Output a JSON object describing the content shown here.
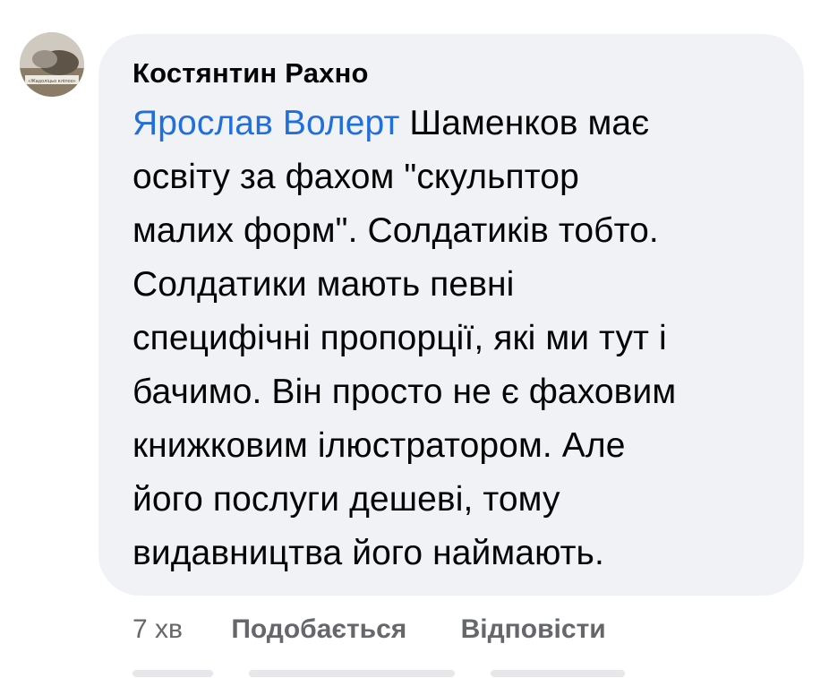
{
  "comment": {
    "avatar": {
      "icon": "profile-photo",
      "caption": "«Жадоліцьо кліпоо»"
    },
    "author": "Костянтин Рахно",
    "mention": "Ярослав Волерт",
    "lines": [
      " Шаменков має",
      "освіту за фахом \"скульптор",
      "малих форм\". Солдатиків тобто.",
      "Солдатики мають певні",
      "специфічні пропорції, які ми тут і",
      "бачимо. Він просто не є фаховим",
      "книжковим ілюстратором. Але",
      "його послуги дешеві, тому",
      "видавництва його наймають."
    ],
    "colors": {
      "bubble": "#f0f2f5",
      "mention": "#216fdb",
      "text": "#050505",
      "meta": "#65676b"
    }
  },
  "actions": {
    "time": "7 хв",
    "like_label": "Подобається",
    "reply_label": "Відповісти"
  }
}
